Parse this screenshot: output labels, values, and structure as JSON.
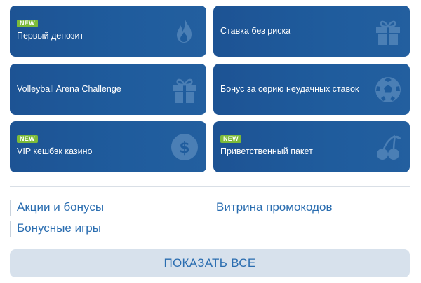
{
  "promos": [
    {
      "badge": "NEW",
      "label": "Первый депозит",
      "icon": "flame-icon"
    },
    {
      "badge": "",
      "label": "Ставка без риска",
      "icon": "gift-icon"
    },
    {
      "badge": "",
      "label": "Volleyball Arena Challenge",
      "icon": "gift-icon"
    },
    {
      "badge": "",
      "label": "Бонус за серию неудачных ставок",
      "icon": "soccer-ball-icon"
    },
    {
      "badge": "NEW",
      "label": "VIP кешбэк казино",
      "icon": "dollar-coin-icon"
    },
    {
      "badge": "NEW",
      "label": "Приветственный пакет",
      "icon": "cherries-icon"
    }
  ],
  "links": {
    "promotions": "Акции и бонусы",
    "promo_codes": "Витрина промокодов",
    "bonus_games": "Бонусные игры"
  },
  "show_all": "ПОКАЗАТЬ ВСЕ",
  "colors": {
    "card_bg": "#1f5c9d",
    "badge_bg": "#7dbb3a",
    "link": "#2a6db0",
    "button_bg": "#d7e1ec"
  }
}
